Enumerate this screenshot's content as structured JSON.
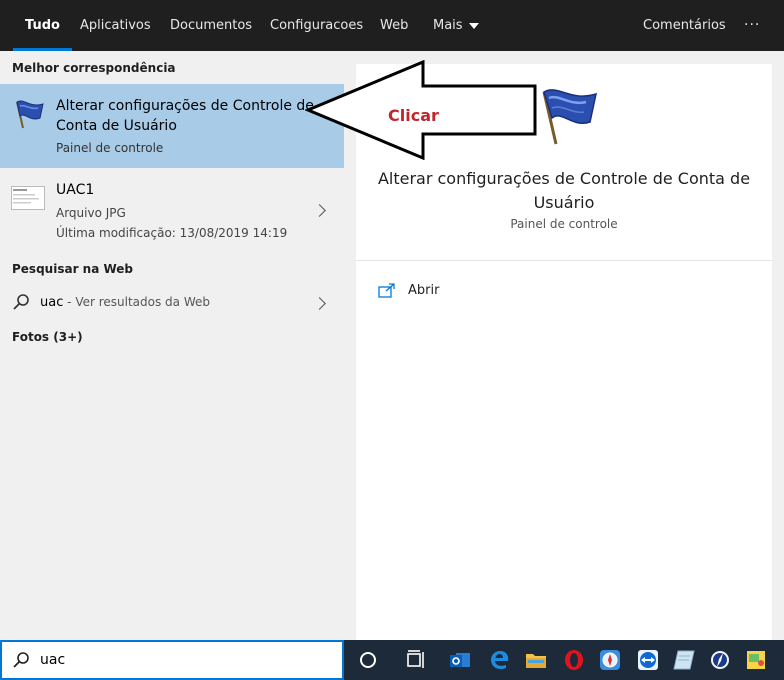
{
  "tabs": [
    {
      "label": "Tudo",
      "active": true
    },
    {
      "label": "Aplicativos"
    },
    {
      "label": "Documentos"
    },
    {
      "label": "Configuracoes"
    },
    {
      "label": "Web"
    },
    {
      "label": "Mais"
    }
  ],
  "header": {
    "feedback": "Comentários",
    "more": "···"
  },
  "sections": {
    "best_match": "Melhor correspondência",
    "web": "Pesquisar na Web",
    "photos": "Fotos (3+)"
  },
  "best_match": {
    "title": "Alterar configurações de Controle de Conta de Usuário",
    "subtitle": "Painel de controle",
    "icon": "uac-flag-icon"
  },
  "file_result": {
    "name": "UAC1",
    "type": "Arquivo JPG",
    "modified": "Última modificação: 13/08/2019 14:19"
  },
  "web_result": {
    "query": "uac",
    "hint": " - Ver resultados da Web"
  },
  "preview": {
    "title": "Alterar configurações de Controle de Conta de Usuário",
    "subtitle": "Painel de controle",
    "open_label": "Abrir"
  },
  "annotation": {
    "label": "Clicar",
    "color": "#c0272d"
  },
  "search": {
    "value": "uac"
  },
  "colors": {
    "accent": "#0078d7",
    "selected": "#a8cbe8",
    "topbar": "#1f1f1f"
  }
}
